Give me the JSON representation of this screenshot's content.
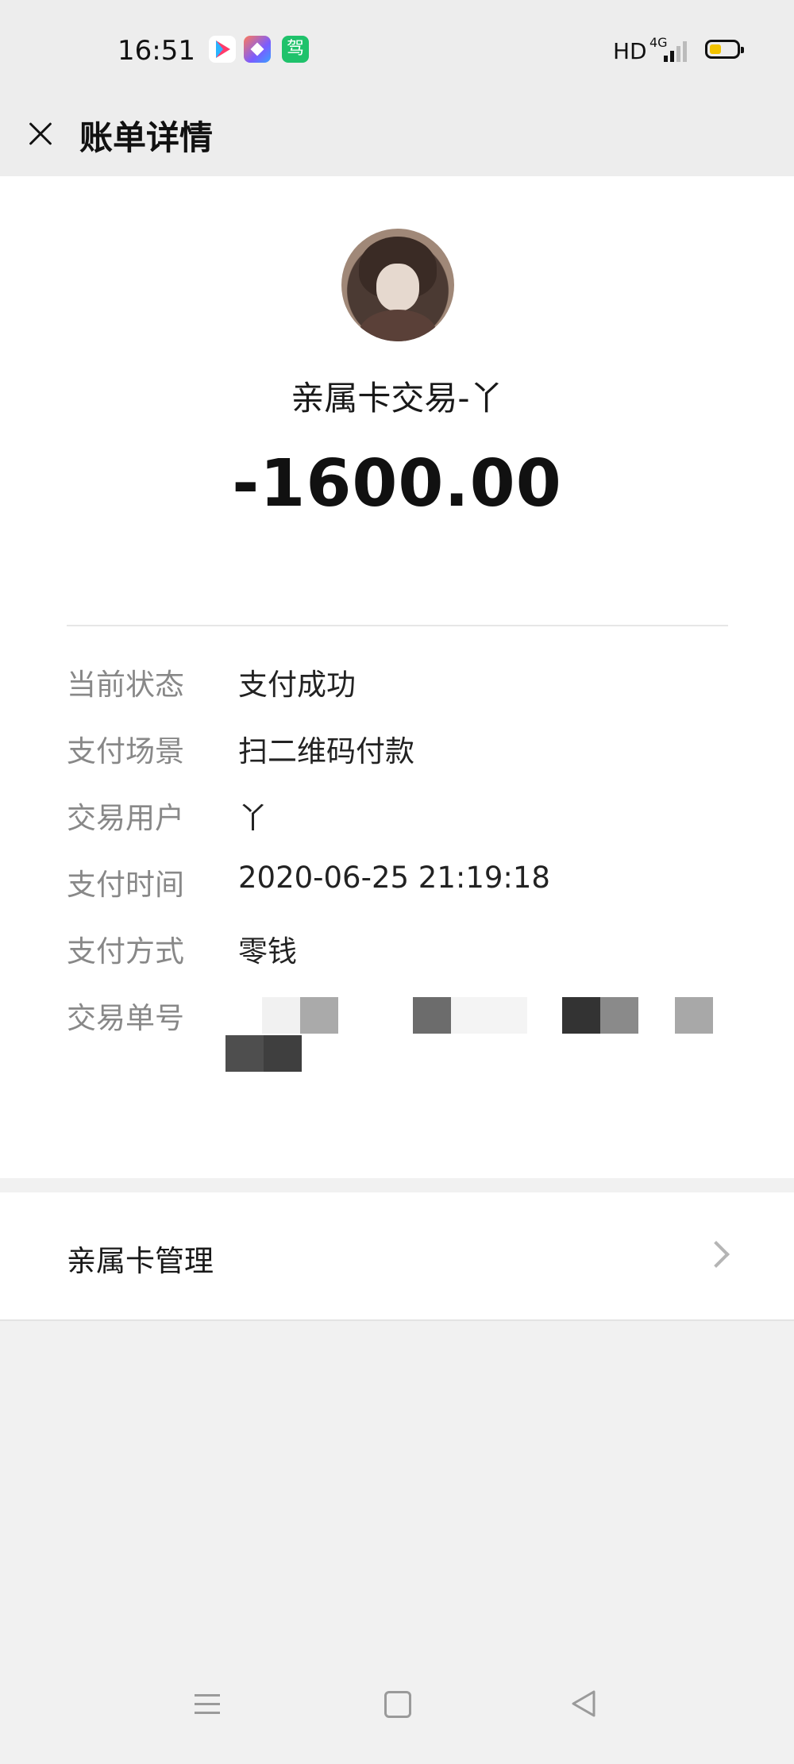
{
  "status_bar": {
    "time": "16:51",
    "hd_label": "HD",
    "network_label": "4G",
    "app_icons": [
      "youyu-icon",
      "editor-icon",
      "driving-school-icon"
    ],
    "app3_glyph": "驾"
  },
  "header": {
    "title": "账单详情",
    "close_icon": "close-icon"
  },
  "transaction": {
    "merchant": "亲属卡交易-丫",
    "amount": "-1600.00"
  },
  "details": [
    {
      "label": "当前状态",
      "value": "支付成功"
    },
    {
      "label": "支付场景",
      "value": "扫二维码付款"
    },
    {
      "label": "交易用户",
      "value": "丫"
    },
    {
      "label": "支付时间",
      "value": "2020-06-25 21:19:18"
    },
    {
      "label": "支付方式",
      "value": "零钱"
    },
    {
      "label": "交易单号",
      "value": ""
    }
  ],
  "family_card": {
    "label": "亲属卡管理",
    "icon": "chevron-right-icon"
  },
  "nav_bar": {
    "icons": [
      "menu-icon",
      "home-icon",
      "back-icon"
    ]
  },
  "colors": {
    "header_bg": "#ededed",
    "page_bg": "#f1f1f1",
    "card_bg": "#ffffff",
    "label_gray": "#888888",
    "battery_yellow": "#f2c300"
  }
}
